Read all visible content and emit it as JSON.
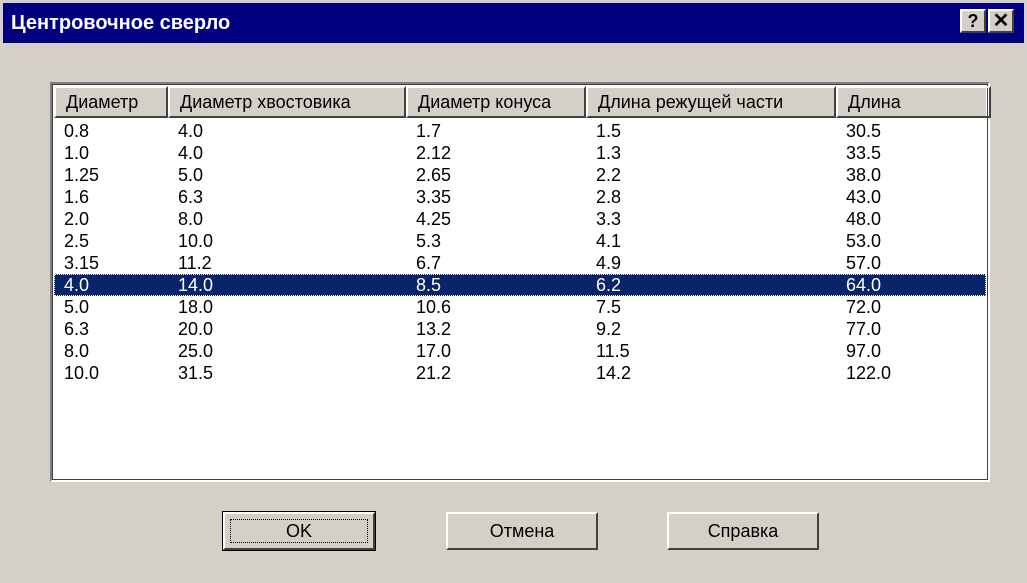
{
  "window": {
    "title": "Центровочное сверло"
  },
  "titlebar_buttons": {
    "help": "?",
    "close": "✕"
  },
  "table": {
    "columns": [
      "Диаметр",
      "Диаметр хвостовика",
      "Диаметр конуса",
      "Длина режущей части",
      "Длина"
    ],
    "rows": [
      [
        "0.8",
        "4.0",
        "1.7",
        "1.5",
        "30.5"
      ],
      [
        "1.0",
        "4.0",
        "2.12",
        "1.3",
        "33.5"
      ],
      [
        "1.25",
        "5.0",
        "2.65",
        "2.2",
        "38.0"
      ],
      [
        "1.6",
        "6.3",
        "3.35",
        "2.8",
        "43.0"
      ],
      [
        "2.0",
        "8.0",
        "4.25",
        "3.3",
        "48.0"
      ],
      [
        "2.5",
        "10.0",
        "5.3",
        "4.1",
        "53.0"
      ],
      [
        "3.15",
        "11.2",
        "6.7",
        "4.9",
        "57.0"
      ],
      [
        "4.0",
        "14.0",
        "8.5",
        "6.2",
        "64.0"
      ],
      [
        "5.0",
        "18.0",
        "10.6",
        "7.5",
        "72.0"
      ],
      [
        "6.3",
        "20.0",
        "13.2",
        "9.2",
        "77.0"
      ],
      [
        "8.0",
        "25.0",
        "17.0",
        "11.5",
        "97.0"
      ],
      [
        "10.0",
        "31.5",
        "21.2",
        "14.2",
        "122.0"
      ]
    ],
    "selected_row": 7
  },
  "buttons": {
    "ok": "OK",
    "cancel": "Отмена",
    "help": "Справка"
  },
  "colors": {
    "titlebar": "#000080",
    "selection": "#0a246a",
    "face": "#d4d0c8"
  }
}
